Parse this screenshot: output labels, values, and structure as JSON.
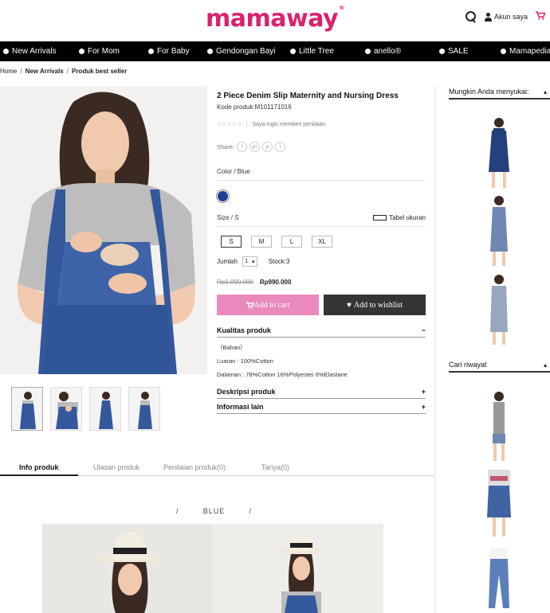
{
  "header": {
    "logo": "mamaway",
    "logo_mark": "®",
    "account_label": "Akun saya",
    "icons": {
      "search": "search-icon",
      "account": "user-icon",
      "cart": "cart-icon"
    }
  },
  "nav": {
    "items": [
      {
        "label": "New Arrivals"
      },
      {
        "label": "For Mom"
      },
      {
        "label": "For Baby"
      },
      {
        "label": "Gendongan Bayi"
      },
      {
        "label": "Little Tree"
      },
      {
        "label": "anello®"
      },
      {
        "label": "SALE"
      },
      {
        "label": "Mamapedia"
      }
    ]
  },
  "breadcrumb": {
    "items": [
      "Home",
      "New Arrivals",
      "Produk best seller"
    ],
    "separator": "/"
  },
  "product": {
    "title": "2 Piece Denim Slip Maternity and Nursing Dress",
    "code_label": "Kode produk:",
    "code": "M101171016",
    "rating_prompt": "Saya ingin memberi penilaian",
    "share_label": "Share:",
    "share_icons": [
      "facebook-icon",
      "google-plus-icon",
      "pinterest-icon",
      "twitter-icon"
    ],
    "color_label": "Color / Blue",
    "swatch_color": "#1f3f94",
    "size_label": "Size / S",
    "size_chart_label": "Tabel ukuran",
    "sizes": [
      "S",
      "M",
      "L",
      "XL"
    ],
    "selected_size": "S",
    "qty_label": "Jumlah",
    "qty_value": "1",
    "stock_label": "Stock:3",
    "old_price": "Rp1.090.000",
    "new_price": "Rp990.000",
    "add_to_cart": "Add to cart",
    "add_to_wishlist": "Add to wishlist",
    "accordion": {
      "quality_title": "Kualitas produk",
      "quality_lines": [
        "（Bahan）",
        "Luaran : 100%Cotton",
        "Dalaman : 78%Cotton 16%Polyester 6%Elastane"
      ],
      "description_title": "Deskripsi produk",
      "other_title": "Informasi lain"
    }
  },
  "tabs": {
    "items": [
      "Info produk",
      "Ulasan produk",
      "Penilaian produk(0)",
      "Tanya(0)"
    ],
    "active": "Info produk"
  },
  "section_heading": {
    "left": "/",
    "text": "BLUE",
    "right": "/"
  },
  "sidebar": {
    "recommend_title": "Mungkin Anda menyukai:",
    "history_title": "Cari riwayat"
  },
  "colors": {
    "brand": "#d9226c",
    "cart_button": "#ea89bb",
    "wishlist_button": "#353535",
    "nav_bg": "#000000"
  }
}
